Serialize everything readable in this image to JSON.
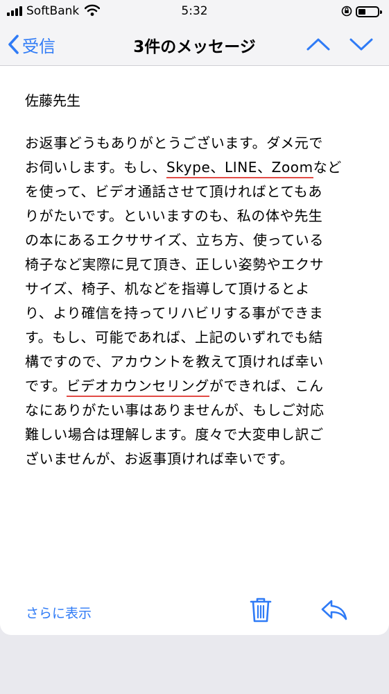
{
  "status": {
    "carrier": "SoftBank",
    "time": "5:32",
    "icons": [
      "signal-icon",
      "wifi-icon",
      "orientation-lock-icon",
      "battery-icon"
    ]
  },
  "nav": {
    "back_label": "受信",
    "title": "3件のメッセージ",
    "icons": [
      "chevron-left-icon",
      "chevron-up-icon",
      "chevron-down-icon"
    ]
  },
  "message": {
    "salutation": "佐藤先生",
    "lines": [
      [
        "お返事どうもありがとうございます。ダメ元で"
      ],
      [
        "お伺いします。もし、",
        "Skype、LINE、Zoom",
        "など"
      ],
      [
        "を使って、ビデオ通話させて頂ければとてもあ"
      ],
      [
        "りがたいです。といいますのも、私の体や先生"
      ],
      [
        "の本にあるエクササイズ、立ち方、使っている"
      ],
      [
        "椅子など実際に見て頂き、正しい姿勢やエクサ"
      ],
      [
        "サイズ、椅子、机などを指導して頂けるとよ"
      ],
      [
        "り、より確信を持ってリハビリする事ができま"
      ],
      [
        "す。もし、可能であれば、上記のいずれでも結"
      ],
      [
        "構ですので、アカウントを教えて頂ければ幸い"
      ],
      [
        "です。",
        "ビデオカウンセリング",
        "ができれば、こん"
      ],
      [
        "なにありがたい事はありませんが、もしご対応"
      ],
      [
        "難しい場合は理解します。度々で大変申し訳ご"
      ],
      [
        "ざいませんが、お返事頂ければ幸いです。"
      ]
    ]
  },
  "toolbar": {
    "show_more": "さらに表示",
    "icons": [
      "trash-icon",
      "reply-icon"
    ]
  },
  "colors": {
    "accent": "#2f7bf6",
    "underline": "#e24a44"
  }
}
